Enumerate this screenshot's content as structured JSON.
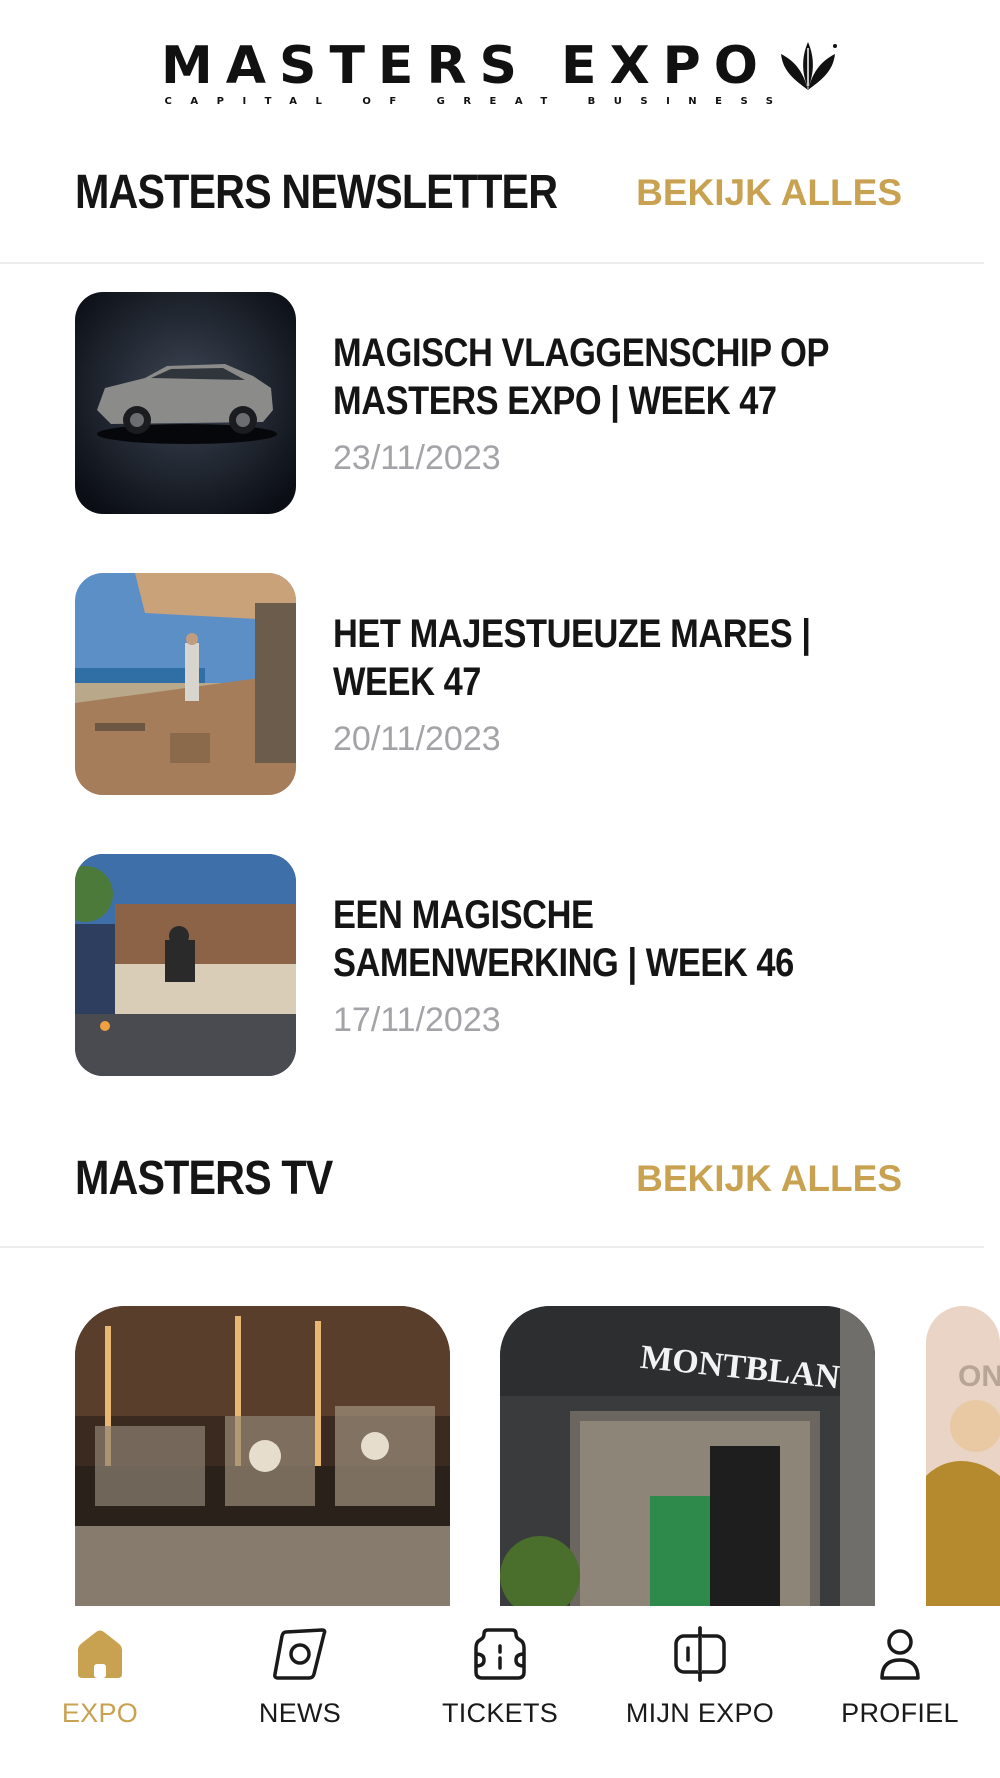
{
  "brand": {
    "name": "MASTERS EXPO",
    "tagline": "CAPITAL OF GREAT BUSINESS",
    "accent_color": "#c9a251"
  },
  "newsletter": {
    "title": "MASTERS NEWSLETTER",
    "see_all": "BEKIJK ALLES",
    "items": [
      {
        "title": "MAGISCH VLAGGENSCHIP OP MASTERS EXPO | WEEK 47",
        "date": "23/11/2023"
      },
      {
        "title": "HET MAJESTUEUZE MARES | WEEK 47",
        "date": "20/11/2023"
      },
      {
        "title": "EEN MAGISCHE SAMENWERKING | WEEK 46",
        "date": "17/11/2023"
      }
    ]
  },
  "tv": {
    "title": "MASTERS TV",
    "see_all": "BEKIJK ALLES",
    "cards": [
      {
        "image_label": ""
      },
      {
        "image_label": "MONTBLANC"
      },
      {
        "image_label": "ON"
      }
    ]
  },
  "nav": {
    "items": [
      {
        "label": "EXPO",
        "icon": "home-icon",
        "active": true
      },
      {
        "label": "NEWS",
        "icon": "compass-icon",
        "active": false
      },
      {
        "label": "TICKETS",
        "icon": "ticket-icon",
        "active": false
      },
      {
        "label": "MIJN EXPO",
        "icon": "badge-icon",
        "active": false
      },
      {
        "label": "PROFIEL",
        "icon": "user-icon",
        "active": false
      }
    ]
  }
}
